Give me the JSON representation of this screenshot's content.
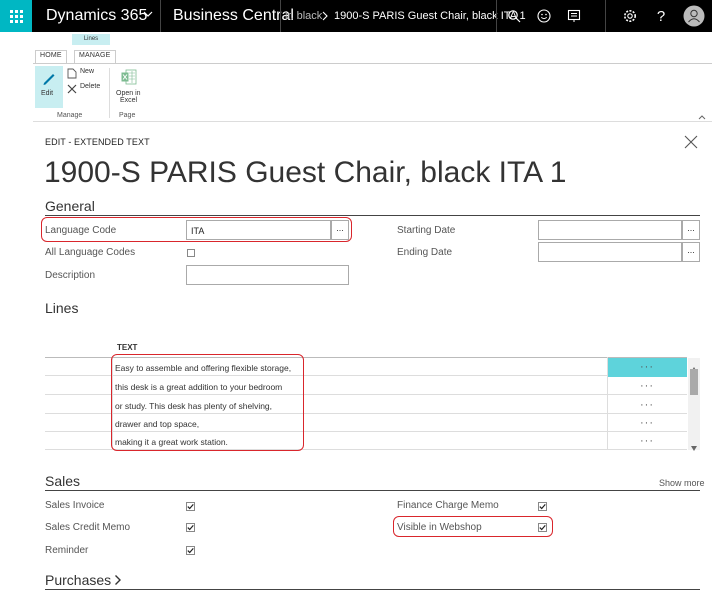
{
  "topbar": {
    "app_name": "Dynamics 365",
    "product": "Business Central",
    "breadcrumb_prev": "ir. black",
    "breadcrumb_current": "1900-S PARIS Guest Chair, black ITA 1"
  },
  "ribbon": {
    "contextual_tab_group": "Lines",
    "tabs": [
      "HOME",
      "MANAGE"
    ],
    "actions": {
      "edit": "Edit",
      "new": "New",
      "delete": "Delete",
      "open_in_excel_1": "Open in",
      "open_in_excel_2": "Excel"
    },
    "groups": [
      "Manage",
      "Page"
    ]
  },
  "page": {
    "caption": "EDIT - EXTENDED TEXT",
    "title": "1900-S PARIS Guest Chair, black ITA 1"
  },
  "general": {
    "title": "General",
    "language_code_label": "Language Code",
    "language_code_value": "ITA",
    "all_language_codes_label": "All Language Codes",
    "all_language_codes_checked": false,
    "description_label": "Description",
    "description_value": "",
    "starting_date_label": "Starting Date",
    "starting_date_value": "",
    "ending_date_label": "Ending Date",
    "ending_date_value": ""
  },
  "lines": {
    "title": "Lines",
    "column_header": "TEXT",
    "row_action": "···",
    "rows": [
      "Easy to assemble and offering flexible storage,",
      "this desk is a great addition to your bedroom",
      "or study. This desk has plenty of shelving,",
      "drawer and top space,",
      "making it a great work station."
    ]
  },
  "sales": {
    "title": "Sales",
    "show_more": "Show more",
    "sales_invoice_label": "Sales Invoice",
    "sales_credit_memo_label": "Sales Credit Memo",
    "reminder_label": "Reminder",
    "finance_charge_memo_label": "Finance Charge Memo",
    "visible_in_webshop_label": "Visible in Webshop",
    "checks": {
      "sales_invoice": true,
      "sales_credit_memo": true,
      "reminder": true,
      "finance_charge_memo": true,
      "visible_in_webshop": true
    }
  },
  "purchases": {
    "title": "Purchases"
  },
  "colors": {
    "accent": "#00b7c3",
    "selected_row": "#5ed3db",
    "highlight": "#d9262c",
    "topbar": "#000000"
  },
  "icons": [
    "waffle-icon",
    "chevron-down-icon",
    "breadcrumb-chevron-icon",
    "search-icon",
    "smiley-icon",
    "feedback-icon",
    "settings-icon",
    "help-icon",
    "user-icon",
    "edit-icon",
    "new-icon",
    "delete-icon",
    "excel-icon",
    "collapse-ribbon-icon",
    "close-icon",
    "chevron-right-icon",
    "checkmark-icon"
  ]
}
